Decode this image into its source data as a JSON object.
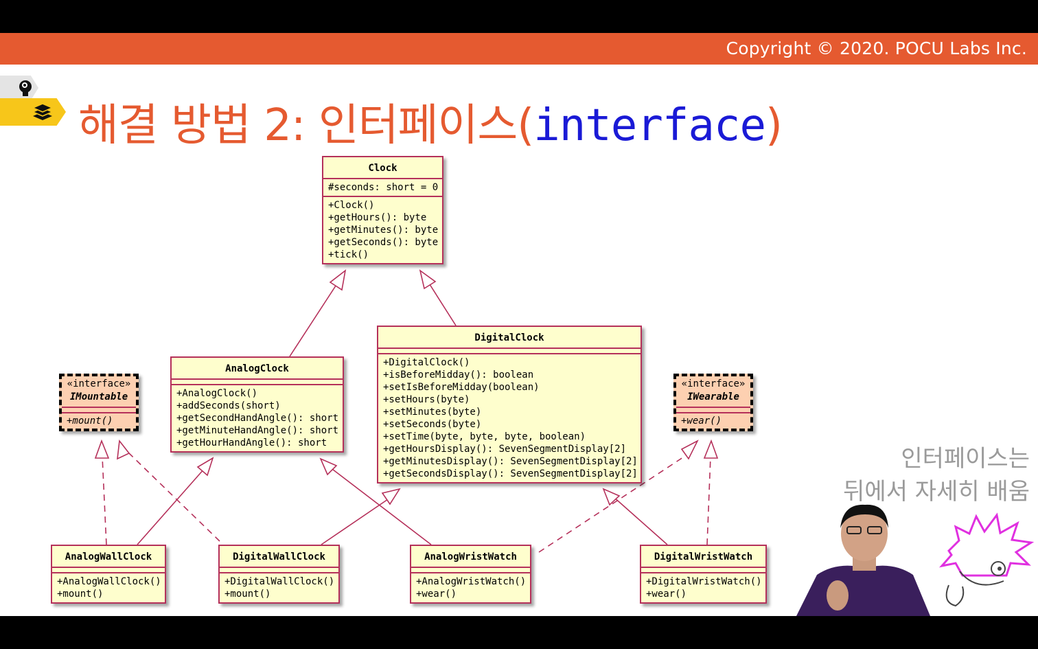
{
  "header": {
    "copyright": "Copyright © 2020. POCU Labs Inc."
  },
  "title": {
    "text": "해결 방법 2: 인터페이스(",
    "code": "interface",
    "close": ")"
  },
  "note": {
    "line1": "인터페이스는",
    "line2": "뒤에서 자세히 배움"
  },
  "classes": {
    "clock": {
      "name": "Clock",
      "fields": "#seconds: short = 0",
      "methods": "+Clock()\n+getHours(): byte\n+getMinutes(): byte\n+getSeconds(): byte\n+tick()"
    },
    "analog_clock": {
      "name": "AnalogClock",
      "methods": "+AnalogClock()\n+addSeconds(short)\n+getSecondHandAngle(): short\n+getMinuteHandAngle(): short\n+getHourHandAngle(): short"
    },
    "digital_clock": {
      "name": "DigitalClock",
      "methods": "+DigitalClock()\n+isBeforeMidday(): boolean\n+setIsBeforeMidday(boolean)\n+setHours(byte)\n+setMinutes(byte)\n+setSeconds(byte)\n+setTime(byte, byte, byte, boolean)\n+getHoursDisplay(): SevenSegmentDisplay[2]\n+getMinutesDisplay(): SevenSegmentDisplay[2]\n+getSecondsDisplay(): SevenSegmentDisplay[2]"
    },
    "imountable": {
      "stereotype": "«interface»",
      "name": "IMountable",
      "methods": "+mount()"
    },
    "iwearable": {
      "stereotype": "«interface»",
      "name": "IWearable",
      "methods": "+wear()"
    },
    "analog_wall_clock": {
      "name": "AnalogWallClock",
      "methods": "+AnalogWallClock()\n+mount()"
    },
    "digital_wall_clock": {
      "name": "DigitalWallClock",
      "methods": "+DigitalWallClock()\n+mount()"
    },
    "analog_wrist_watch": {
      "name": "AnalogWristWatch",
      "methods": "+AnalogWristWatch()\n+wear()"
    },
    "digital_wrist_watch": {
      "name": "DigitalWristWatch",
      "methods": "+DigitalWristWatch()\n+wear()"
    }
  },
  "colors": {
    "accent": "#e55a30",
    "code": "#1a1ad6",
    "class_fill": "#fefecd",
    "class_border": "#b5305a",
    "interface_fill": "#fdd0b1"
  }
}
